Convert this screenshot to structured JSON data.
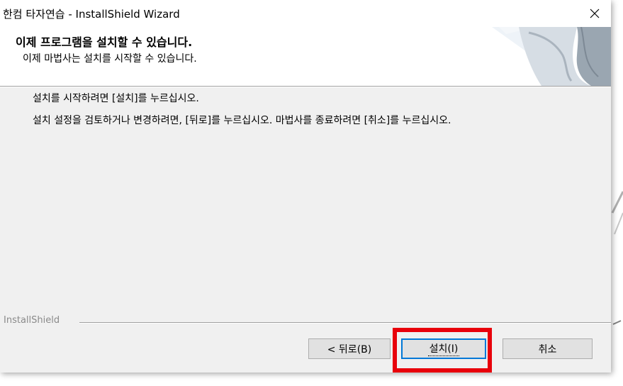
{
  "window": {
    "title": "한컴 타자연습 - InstallShield Wizard",
    "close_glyph": "✕"
  },
  "header": {
    "title": "이제 프로그램을 설치할 수 있습니다.",
    "subtitle": "이제 마법사는 설치를 시작할 수 있습니다."
  },
  "body": {
    "instruction": "설치를 시작하려면 [설치]를 누르십시오.",
    "review": "설치 설정을 검토하거나 변경하려면, [뒤로]를 누르십시오. 마법사를 종료하려면 [취소]를 누르십시오."
  },
  "footer": {
    "brand": "InstallShield"
  },
  "buttons": {
    "back": "< 뒤로(B)",
    "install": "설치(I)",
    "cancel": "취소"
  },
  "colors": {
    "highlight": "#e8000b",
    "focus_border": "#0078d7",
    "dialog_bg": "#f0f0f0"
  }
}
